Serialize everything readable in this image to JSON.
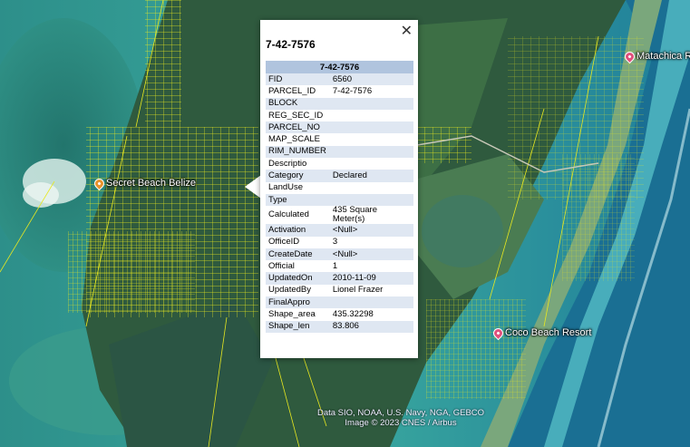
{
  "places": [
    {
      "label": "Secret Beach Belize",
      "pin_color": "#e8922c"
    },
    {
      "label": "Matachica R",
      "pin_color": "#e0507c"
    },
    {
      "label": "Coco Beach Resort",
      "pin_color": "#e0507c"
    }
  ],
  "popup": {
    "close_icon": "close-icon",
    "title": "7-42-7576",
    "table_header": "7-42-7576",
    "rows": [
      {
        "key": "FID",
        "value": "6560"
      },
      {
        "key": "PARCEL_ID",
        "value": "7-42-7576"
      },
      {
        "key": "BLOCK",
        "value": ""
      },
      {
        "key": "REG_SEC_ID",
        "value": ""
      },
      {
        "key": "PARCEL_NO",
        "value": ""
      },
      {
        "key": "MAP_SCALE",
        "value": ""
      },
      {
        "key": "RIM_NUMBER",
        "value": ""
      },
      {
        "key": "Descriptio",
        "value": ""
      },
      {
        "key": "Category",
        "value": "Declared"
      },
      {
        "key": "LandUse",
        "value": ""
      },
      {
        "key": "Type",
        "value": ""
      },
      {
        "key": "Calculated",
        "value": "435 Square Meter(s)"
      },
      {
        "key": "Activation",
        "value": "<Null>"
      },
      {
        "key": "OfficeID",
        "value": "3"
      },
      {
        "key": "CreateDate",
        "value": "<Null>"
      },
      {
        "key": "Official",
        "value": "1"
      },
      {
        "key": "UpdatedOn",
        "value": "2010-11-09"
      },
      {
        "key": "UpdatedBy",
        "value": "Lionel Frazer"
      },
      {
        "key": "FinalAppro",
        "value": ""
      },
      {
        "key": "Shape_area",
        "value": "435.32298"
      },
      {
        "key": "Shape_len",
        "value": "83.806"
      }
    ]
  },
  "attribution": {
    "line1": "Data SIO, NOAA, U.S. Navy, NGA, GEBCO",
    "line2": "Image © 2023 CNES / Airbus"
  }
}
